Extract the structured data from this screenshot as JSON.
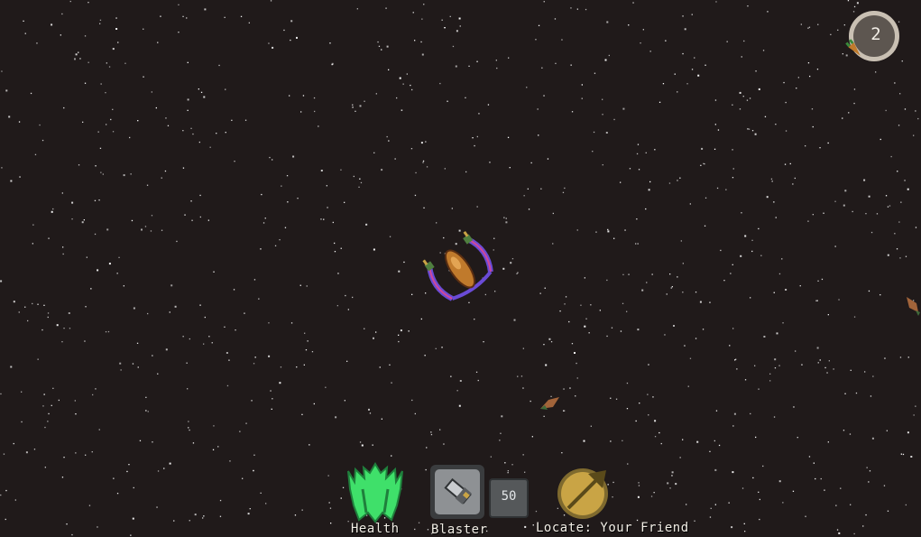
{
  "hud": {
    "counter_value": "2",
    "health_label": "Health",
    "weapon_label": "Blaster",
    "ammo_count": "50",
    "locate_label": "Locate: Your Friend"
  },
  "colors": {
    "background": "#201a1a",
    "star": "#ffffff",
    "health_green": "#3fe06a",
    "compass_gold": "#c9a445",
    "ship_purple": "#6a4bd6",
    "ship_magenta": "#d0489a"
  },
  "icons": {
    "health": "health-flame-icon",
    "weapon": "blaster-icon",
    "locate": "compass-arrow-icon",
    "counter": "carrot-counter-icon"
  }
}
